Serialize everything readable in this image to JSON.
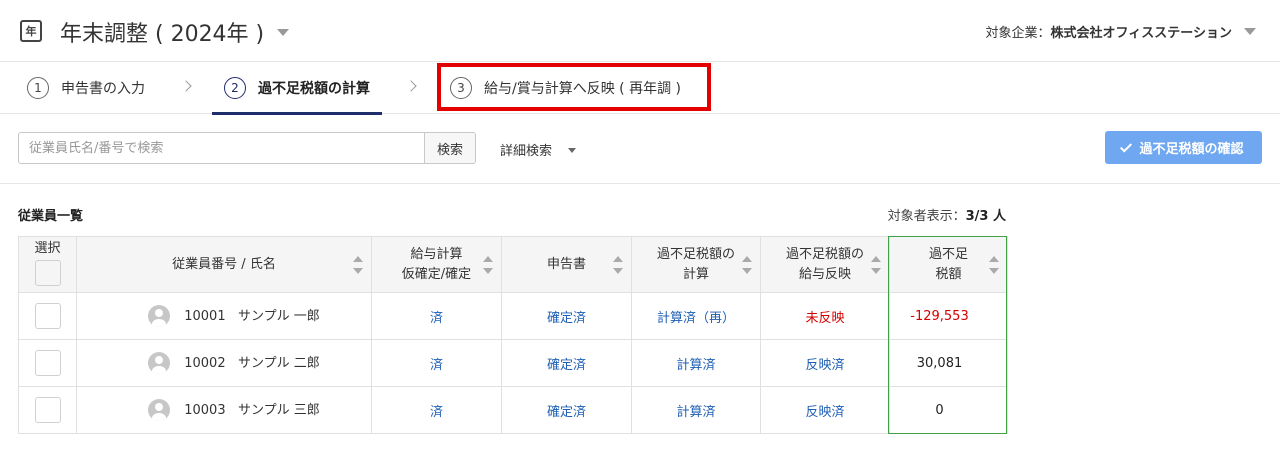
{
  "header": {
    "app_icon": "年",
    "title": "年末調整 ( 2024年 )",
    "company_prefix": "対象企業：",
    "company_name": "株式会社オフィスステーション"
  },
  "steps": [
    {
      "number": "1",
      "label": "申告書の入力"
    },
    {
      "number": "2",
      "label": "過不足税額の計算"
    },
    {
      "number": "3",
      "label": "給与/賞与計算へ反映 ( 再年調 )"
    }
  ],
  "toolbar": {
    "search_placeholder": "従業員氏名/番号で検索",
    "search_button": "検索",
    "advanced_search": "詳細検索",
    "confirm_button": "過不足税額の確認"
  },
  "section": {
    "title": "従業員一覧",
    "count_label": "対象者表示：",
    "count_value": "3/3 人"
  },
  "table": {
    "headers": {
      "select": "選択",
      "employee": "従業員番号 / 氏名",
      "payroll_line1": "給与計算",
      "payroll_line2": "仮確定/確定",
      "declaration": "申告書",
      "calc_line1": "過不足税額の",
      "calc_line2": "計算",
      "reflect_line1": "過不足税額の",
      "reflect_line2": "給与反映",
      "amount_line1": "過不足",
      "amount_line2": "税額"
    },
    "rows": [
      {
        "id": "10001",
        "name": "サンプル 一郎",
        "payroll": "済",
        "declaration": "確定済",
        "calc": "計算済（再）",
        "reflect": "未反映",
        "amount": "-129,553"
      },
      {
        "id": "10002",
        "name": "サンプル 二郎",
        "payroll": "済",
        "declaration": "確定済",
        "calc": "計算済",
        "reflect": "反映済",
        "amount": "30,081"
      },
      {
        "id": "10003",
        "name": "サンプル 三郎",
        "payroll": "済",
        "declaration": "確定済",
        "calc": "計算済",
        "reflect": "反映済",
        "amount": "0"
      }
    ]
  },
  "colors": {
    "link": "#1e5fb4",
    "negative": "#d40000",
    "active_step": "#1f2d6b",
    "confirm_button": "#6fa8f0",
    "highlight": "#e30000",
    "column_frame": "#43a047"
  }
}
